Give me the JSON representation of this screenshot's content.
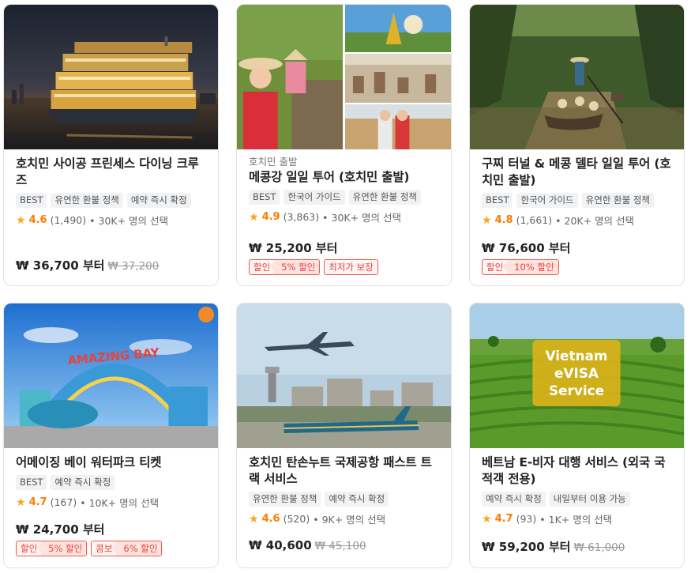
{
  "cards": [
    {
      "title": "호치민 사이공 프린세스 다이닝 크루즈",
      "tags": [
        "BEST",
        "유연한 환불 정책",
        "예약 즉시 확정"
      ],
      "rating": "4.6",
      "reviews": "(1,490)",
      "selected": "• 30K+ 명의 선택",
      "price": "₩ 36,700 부터",
      "old_price": "₩ 37,200"
    },
    {
      "subtitle": "호치민 출발",
      "title": "메콩강 일일 투어 (호치민 출발)",
      "tags": [
        "BEST",
        "한국어 가이드",
        "유연한 환불 정책"
      ],
      "rating": "4.9",
      "reviews": "(3,863)",
      "selected": "• 30K+ 명의 선택",
      "price": "₩ 25,200 부터",
      "badges": [
        {
          "label": "할인",
          "value": "5% 할인"
        },
        {
          "label": "최저가 보장"
        }
      ]
    },
    {
      "title": "구찌 터널 & 메콩 델타 일일 투어 (호치민 출발)",
      "tags": [
        "BEST",
        "한국어 가이드",
        "유연한 환불 정책"
      ],
      "rating": "4.8",
      "reviews": "(1,661)",
      "selected": "• 20K+ 명의 선택",
      "price": "₩ 76,600 부터",
      "badges": [
        {
          "label": "할인",
          "value": "10% 할인"
        }
      ]
    },
    {
      "title": "어메이징 베이 워터파크 티켓",
      "tags": [
        "BEST",
        "예약 즉시 확정"
      ],
      "rating": "4.7",
      "reviews": "(167)",
      "selected": "• 10K+ 명의 선택",
      "price": "₩ 24,700 부터",
      "badges": [
        {
          "label": "할인",
          "value": "5% 할인"
        },
        {
          "label": "콤보",
          "value": "6% 할인"
        }
      ],
      "image_text": "AMAZING BAY"
    },
    {
      "title": "호치민 탄손누트 국제공항 패스트 트랙 서비스",
      "tags": [
        "유연한 환불 정책",
        "예약 즉시 확정"
      ],
      "rating": "4.6",
      "reviews": "(520)",
      "selected": "• 9K+ 명의 선택",
      "price": "₩ 40,600",
      "old_price": "₩ 45,100"
    },
    {
      "title": "베트남 E-비자 대행 서비스 (외국 국적객 전용)",
      "tags": [
        "예약 즉시 확정",
        "내일부터 이용 가능"
      ],
      "rating": "4.7",
      "reviews": "(93)",
      "selected": "• 1K+ 명의 선택",
      "price": "₩ 59,200 부터",
      "old_price": "₩ 61,000",
      "image_text": [
        "Vietnam",
        "eVISA",
        "Service"
      ]
    }
  ],
  "icons": {
    "rating": "star-icon"
  },
  "colors": {
    "accent": "#ff7a00",
    "star": "#f6a623",
    "discount": "#e8423d"
  }
}
